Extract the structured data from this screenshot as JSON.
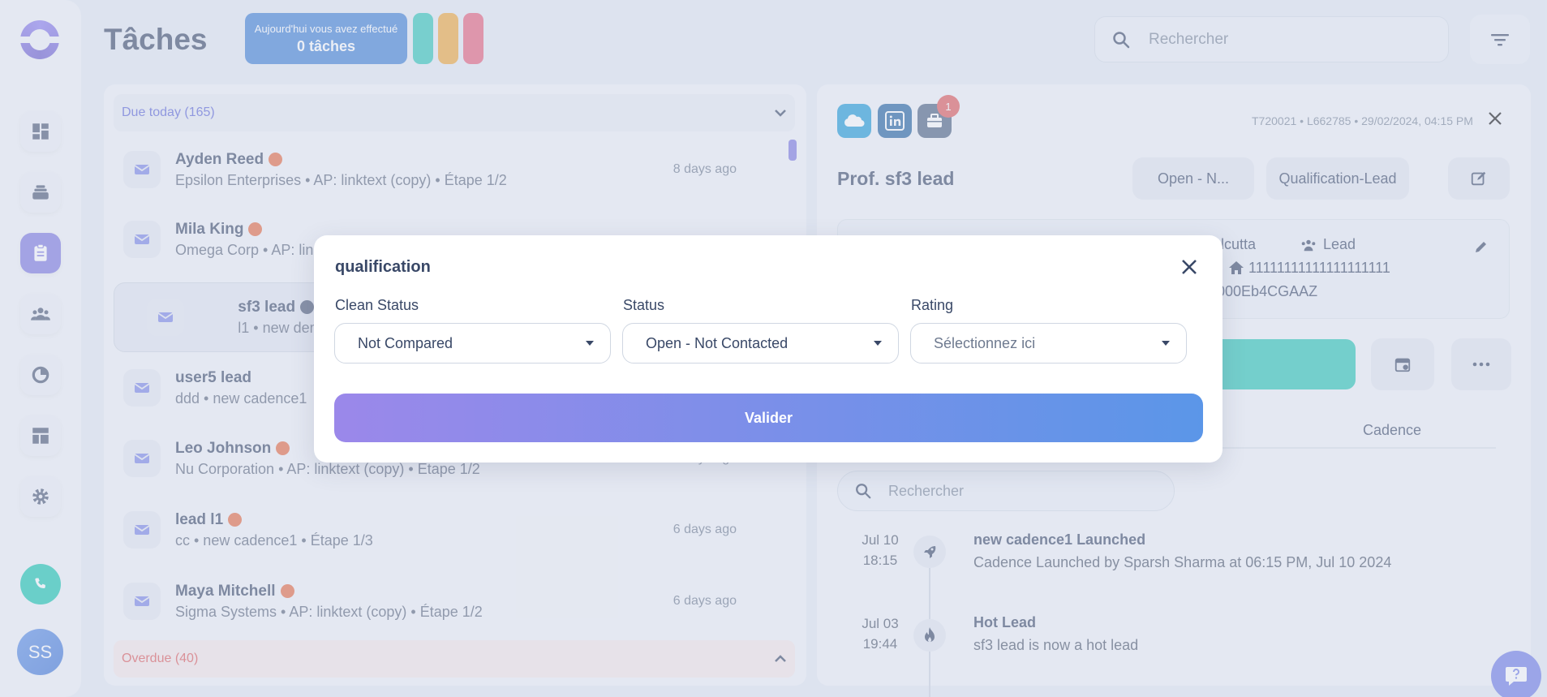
{
  "sidebar": {
    "avatar_initials": "SS",
    "nav_icons": [
      "dashboard-icon",
      "stack-icon",
      "tasks-icon",
      "people-icon",
      "pie-chart-icon",
      "layout-icon",
      "gear-icon"
    ],
    "active_index": 2
  },
  "header": {
    "title": "Tâches",
    "done_line1": "Aujourd'hui vous avez effectué",
    "done_line2": "0 tâches",
    "pill_colors": [
      "#2ec6b8",
      "#f0a83a",
      "#e8607a"
    ],
    "search_placeholder": "Rechercher"
  },
  "task_list": {
    "due_label": "Due today (165)",
    "overdue_label": "Overdue (40)",
    "tasks": [
      {
        "name": "Ayden Reed",
        "sub": "Epsilon Enterprises • AP: linktext (copy) • Étape 1/2",
        "ago": "8 days ago",
        "badge": "orange"
      },
      {
        "name": "Mila King",
        "sub": "Omega Corp • AP: lin",
        "ago": "",
        "badge": "orange"
      },
      {
        "name": "sf3 lead",
        "sub": "l1 • new demo • Étap",
        "ago": "",
        "badge": "globe"
      },
      {
        "name": "user5 lead",
        "sub": "ddd • new cadence1",
        "ago": "",
        "badge": "none"
      },
      {
        "name": "Leo Johnson",
        "sub": "Nu Corporation • AP: linktext (copy) • Étape 1/2",
        "ago": "6 days ago",
        "badge": "orange"
      },
      {
        "name": "lead l1",
        "sub": "cc • new cadence1 • Étape 1/3",
        "ago": "6 days ago",
        "badge": "orange"
      },
      {
        "name": "Maya Mitchell",
        "sub": "Sigma Systems • AP: linktext (copy) • Étape 1/2",
        "ago": "6 days ago",
        "badge": "orange"
      }
    ]
  },
  "detail": {
    "notification_count": "1",
    "meta": "T720021 • L662785 • 29/02/2024, 04:15 PM",
    "lead_name": "Prof. sf3 lead",
    "status_button": "Open - N...",
    "cadence_button": "Qualification-Lead",
    "info_timezone": "a/Calcutta",
    "info_type": "Lead",
    "info_phone": "11111111111111111111",
    "info_id": "w00000Eb4CGAAZ",
    "tab_cadence": "Cadence",
    "search_placeholder": "Rechercher",
    "timeline": [
      {
        "date": "Jul 10",
        "time": "18:15",
        "icon": "rocket-icon",
        "title": "new cadence1 Launched",
        "sub": "Cadence Launched by Sparsh Sharma at 06:15 PM, Jul 10 2024"
      },
      {
        "date": "Jul 03",
        "time": "19:44",
        "icon": "fire-icon",
        "title": "Hot Lead",
        "sub": "sf3 lead is now a hot lead"
      }
    ]
  },
  "modal": {
    "title": "qualification",
    "fields": [
      {
        "label": "Clean Status",
        "value": "Not Compared"
      },
      {
        "label": "Status",
        "value": "Open - Not Contacted"
      },
      {
        "label": "Rating",
        "value": "Sélectionnez ici"
      }
    ],
    "submit_label": "Valider"
  }
}
